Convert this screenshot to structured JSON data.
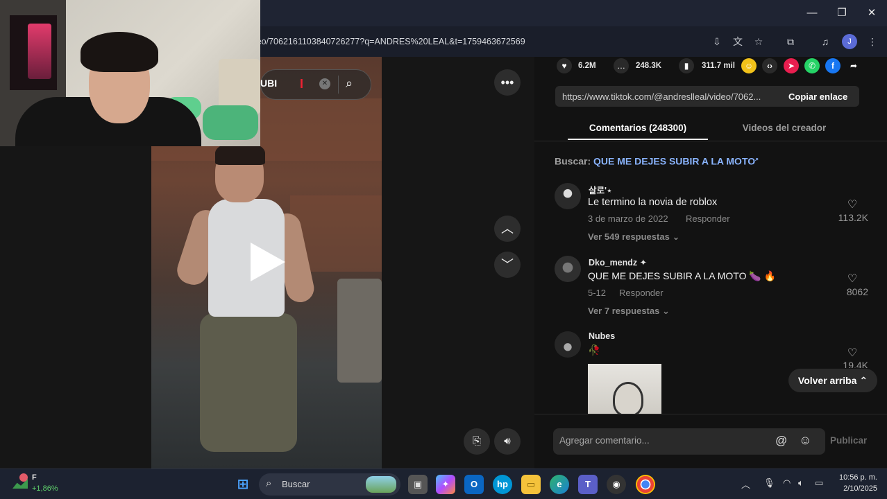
{
  "browser": {
    "url": "ideo/7062161103840726277?q=ANDRES%20LEAL&t=1759463672569",
    "window_controls": {
      "minimize": "—",
      "maximize": "❐",
      "close": "✕"
    }
  },
  "video": {
    "search_fragment": "UBI",
    "icons": [
      "more-icon",
      "chevron-up-icon",
      "chevron-down-icon",
      "play-icon",
      "clipboard-icon",
      "volume-icon"
    ]
  },
  "stats": {
    "likes": "6.2M",
    "comments": "248.3K",
    "saves": "311.7 mil"
  },
  "share": {
    "link": "https://www.tiktok.com/@andreslleal/video/7062...",
    "copy_label": "Copiar enlace"
  },
  "tabs": {
    "comments": "Comentarios (248300)",
    "creator_videos": "Videos del creador"
  },
  "search_hint": {
    "prefix": "Buscar:",
    "term": "QUE ME DEJES SUBIR A LA MOTO"
  },
  "comments": [
    {
      "user": "살로'⋆",
      "text": "Le termino la novia de roblox",
      "date": "3 de marzo de 2022",
      "reply": "Responder",
      "likes": "113.2K",
      "more": "Ver 549 respuestas"
    },
    {
      "user": "Dko_mendz ✦",
      "text": "QUE ME DEJES SUBIR A LA MOTO 🍆 🔥",
      "date": "5-12",
      "reply": "Responder",
      "likes": "8062",
      "more": "Ver 7 respuestas"
    },
    {
      "user": "Nubes",
      "text": "🥀",
      "likes": "19.4K"
    }
  ],
  "back_to_top": "Volver arriba",
  "comment_input": {
    "placeholder": "Agregar comentario...",
    "publish": "Publicar"
  },
  "taskbar": {
    "weather_letter": "F",
    "weather_change": "+1,86%",
    "search_label": "Buscar",
    "time": "10:56 p. m.",
    "date": "2/10/2025"
  },
  "colors": {
    "accent_link": "#8ab4ff",
    "background": "#121212",
    "taskbar": "#1c2230"
  }
}
